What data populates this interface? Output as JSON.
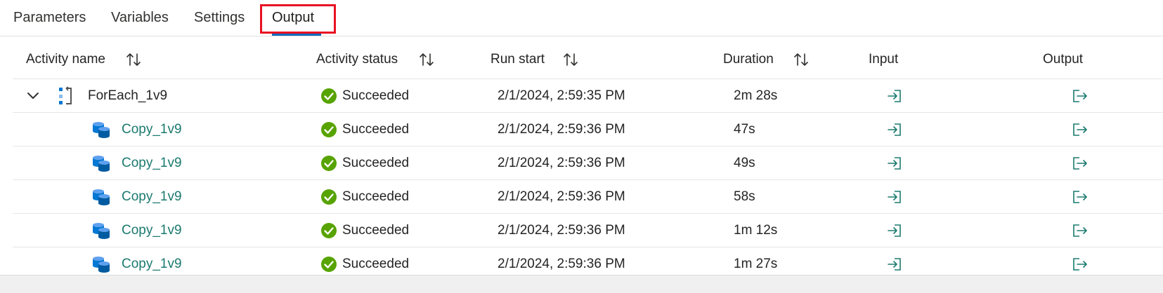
{
  "tabs": [
    {
      "label": "Parameters"
    },
    {
      "label": "Variables"
    },
    {
      "label": "Settings"
    },
    {
      "label": "Output"
    }
  ],
  "active_tab": "Output",
  "columns": {
    "activity_name": "Activity name",
    "activity_status": "Activity status",
    "run_start": "Run start",
    "duration": "Duration",
    "input": "Input",
    "output": "Output"
  },
  "rows": [
    {
      "name": "ForEach_1v9",
      "status": "Succeeded",
      "run_start": "2/1/2024, 2:59:35 PM",
      "duration": "2m 28s",
      "icon": "foreach-icon"
    },
    {
      "name": "Copy_1v9",
      "status": "Succeeded",
      "run_start": "2/1/2024, 2:59:36 PM",
      "duration": "47s",
      "icon": "copy-data-icon"
    },
    {
      "name": "Copy_1v9",
      "status": "Succeeded",
      "run_start": "2/1/2024, 2:59:36 PM",
      "duration": "49s",
      "icon": "copy-data-icon"
    },
    {
      "name": "Copy_1v9",
      "status": "Succeeded",
      "run_start": "2/1/2024, 2:59:36 PM",
      "duration": "58s",
      "icon": "copy-data-icon"
    },
    {
      "name": "Copy_1v9",
      "status": "Succeeded",
      "run_start": "2/1/2024, 2:59:36 PM",
      "duration": "1m 12s",
      "icon": "copy-data-icon"
    },
    {
      "name": "Copy_1v9",
      "status": "Succeeded",
      "run_start": "2/1/2024, 2:59:36 PM",
      "duration": "1m 27s",
      "icon": "copy-data-icon"
    }
  ],
  "colors": {
    "success": "#57a300",
    "link": "#1b7a6f",
    "highlight": "#e81123",
    "copy_icon": "#0078d4"
  }
}
